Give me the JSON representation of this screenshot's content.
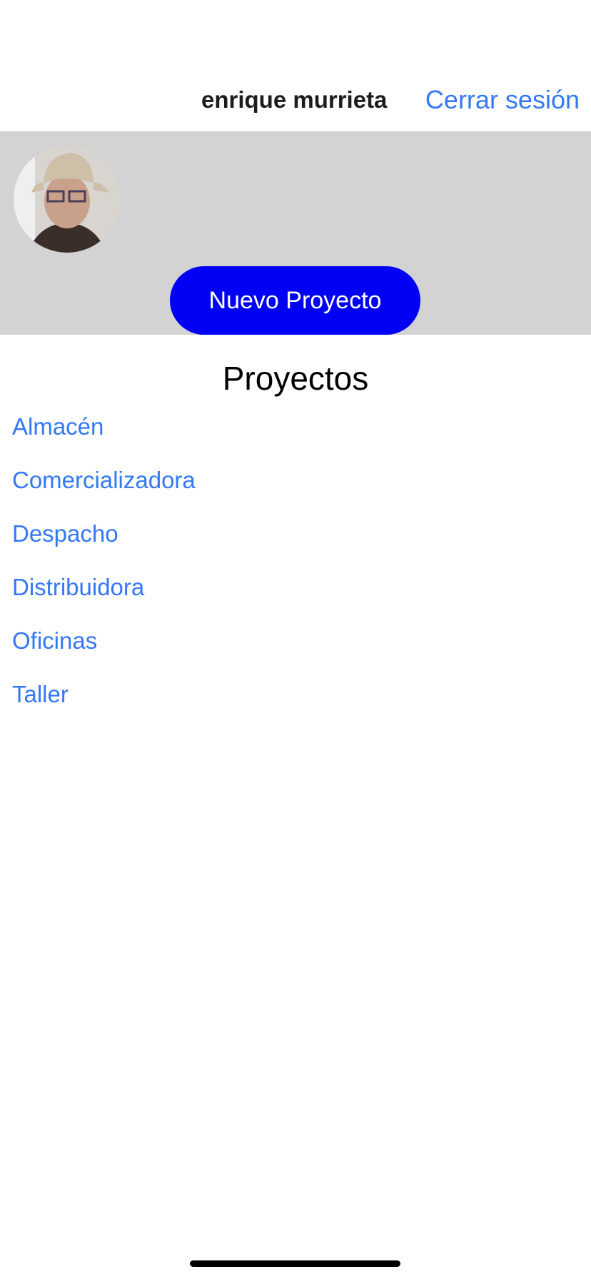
{
  "header": {
    "user_name": "enrique murrieta",
    "logout_label": "Cerrar sesión"
  },
  "profile": {
    "avatar": "user-photo",
    "new_project_label": "Nuevo Proyecto"
  },
  "projects": {
    "title": "Proyectos",
    "items": [
      "Almacén",
      "Comercializadora",
      "Despacho",
      "Distribuidora",
      "Oficinas",
      "Taller"
    ]
  },
  "colors": {
    "link": "#3478f6",
    "button": "#0000f5",
    "band": "#d3d3d3"
  }
}
